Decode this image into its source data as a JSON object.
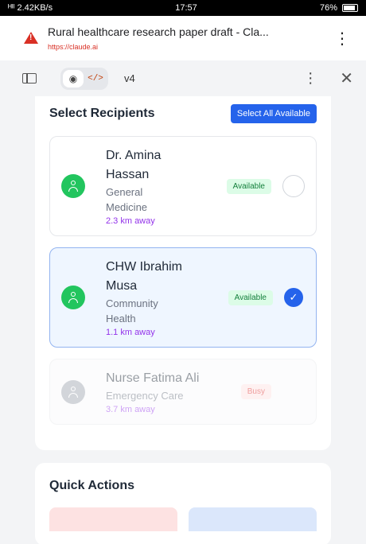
{
  "statusbar": {
    "left": "ᴴᴵᴵ 2.42KB/s",
    "time": "17:57",
    "battery": "76%"
  },
  "browser": {
    "title": "Rural healthcare research paper draft - Cla...",
    "url": "https://claude.ai"
  },
  "artifact": {
    "version": "v4"
  },
  "recipients": {
    "heading": "Select Recipients",
    "select_all_label": "Select All Available",
    "items": [
      {
        "name_line1": "Dr. Amina",
        "name_line2": "Hassan",
        "specialty_line1": "General",
        "specialty_line2": "Medicine",
        "distance": "2.3 km away",
        "status": "Available",
        "selected": false
      },
      {
        "name_line1": "CHW Ibrahim",
        "name_line2": "Musa",
        "specialty_line1": "Community",
        "specialty_line2": "Health",
        "distance": "1.1 km away",
        "status": "Available",
        "selected": true
      },
      {
        "name_line1": "Nurse Fatima Ali",
        "specialty_line1": "Emergency Care",
        "distance": "3.7 km away",
        "status": "Busy",
        "selected": false
      }
    ]
  },
  "quick_actions": {
    "heading": "Quick Actions"
  },
  "colors": {
    "primary": "#2563eb",
    "available_green": "#22c55e",
    "distance_purple": "#9333ea",
    "busy_red": "#dc2626"
  }
}
